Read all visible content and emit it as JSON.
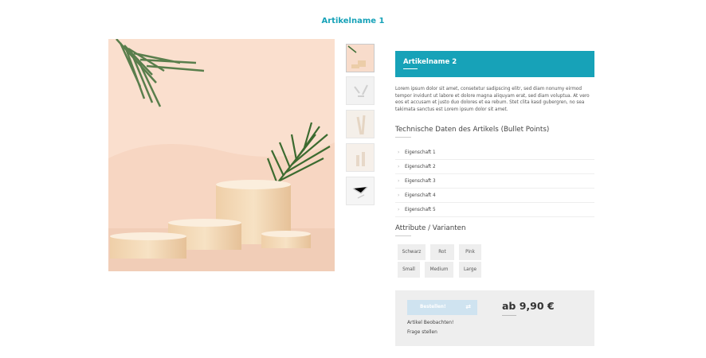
{
  "page": {
    "title": "Artikelname 1"
  },
  "product": {
    "name": "Artikelname 2",
    "description": "Lorem ipsum dolor sit amet, consetetur sadipscing elitr, sed diam nonumy eirmod tempor invidunt ut labore et dolore magna aliquyam erat, sed diam voluptua. At vero eos et accusam et justo duo dolores et ea rebum. Stet clita kasd gubergren, no sea takimata sanctus est Lorem ipsum dolor sit amet.",
    "specs_heading": "Technische Daten des Artikels (Bullet Points)",
    "properties": [
      "Eigenschaft 1",
      "Eigenschaft 2",
      "Eigenschaft 3",
      "Eigenschaft 4",
      "Eigenschaft 5"
    ],
    "variants_heading": "Attribute / Varianten",
    "variants_row1": [
      "Schwarz",
      "Rot",
      "Pink"
    ],
    "variants_row2": [
      "Small",
      "Medium",
      "Large"
    ]
  },
  "buy": {
    "order_label": "Bestellen!",
    "price": "ab 9,90 €",
    "watch_label": "Artikel Beobachten!",
    "question_label": "Frage stellen"
  },
  "colors": {
    "accent": "#17a2b8",
    "button_disabled": "#cfe3f0",
    "panel": "#eeeeee"
  },
  "icons": {
    "order": "cart-arrow-icon",
    "property": "chevron-right-icon"
  }
}
